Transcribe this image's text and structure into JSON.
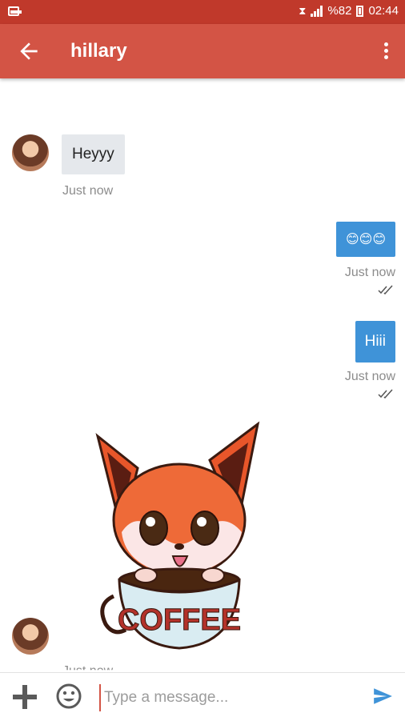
{
  "status_bar": {
    "battery": "%82",
    "time": "02:44"
  },
  "header": {
    "title": "hillary"
  },
  "messages": [
    {
      "direction": "incoming",
      "text": "Heyyy",
      "time": "Just now"
    },
    {
      "direction": "outgoing",
      "text": "😊😊😊",
      "time": "Just now",
      "status": "read"
    },
    {
      "direction": "outgoing",
      "text": "Hiii",
      "time": "Just now",
      "status": "read"
    },
    {
      "direction": "incoming",
      "type": "sticker",
      "sticker_text": "COFFEE",
      "time": "Just now"
    }
  ],
  "composer": {
    "placeholder": "Type a message..."
  },
  "colors": {
    "app_bar": "#d35445",
    "status_bar": "#c0392b",
    "outgoing_bubble": "#3f93d8",
    "incoming_bubble": "#e5e8ec",
    "send_icon": "#3f93d8"
  },
  "icons": {
    "back": "arrow-left-icon",
    "menu": "more-vert-icon",
    "attach": "plus-icon",
    "emoji": "smiley-icon",
    "send": "send-icon"
  }
}
